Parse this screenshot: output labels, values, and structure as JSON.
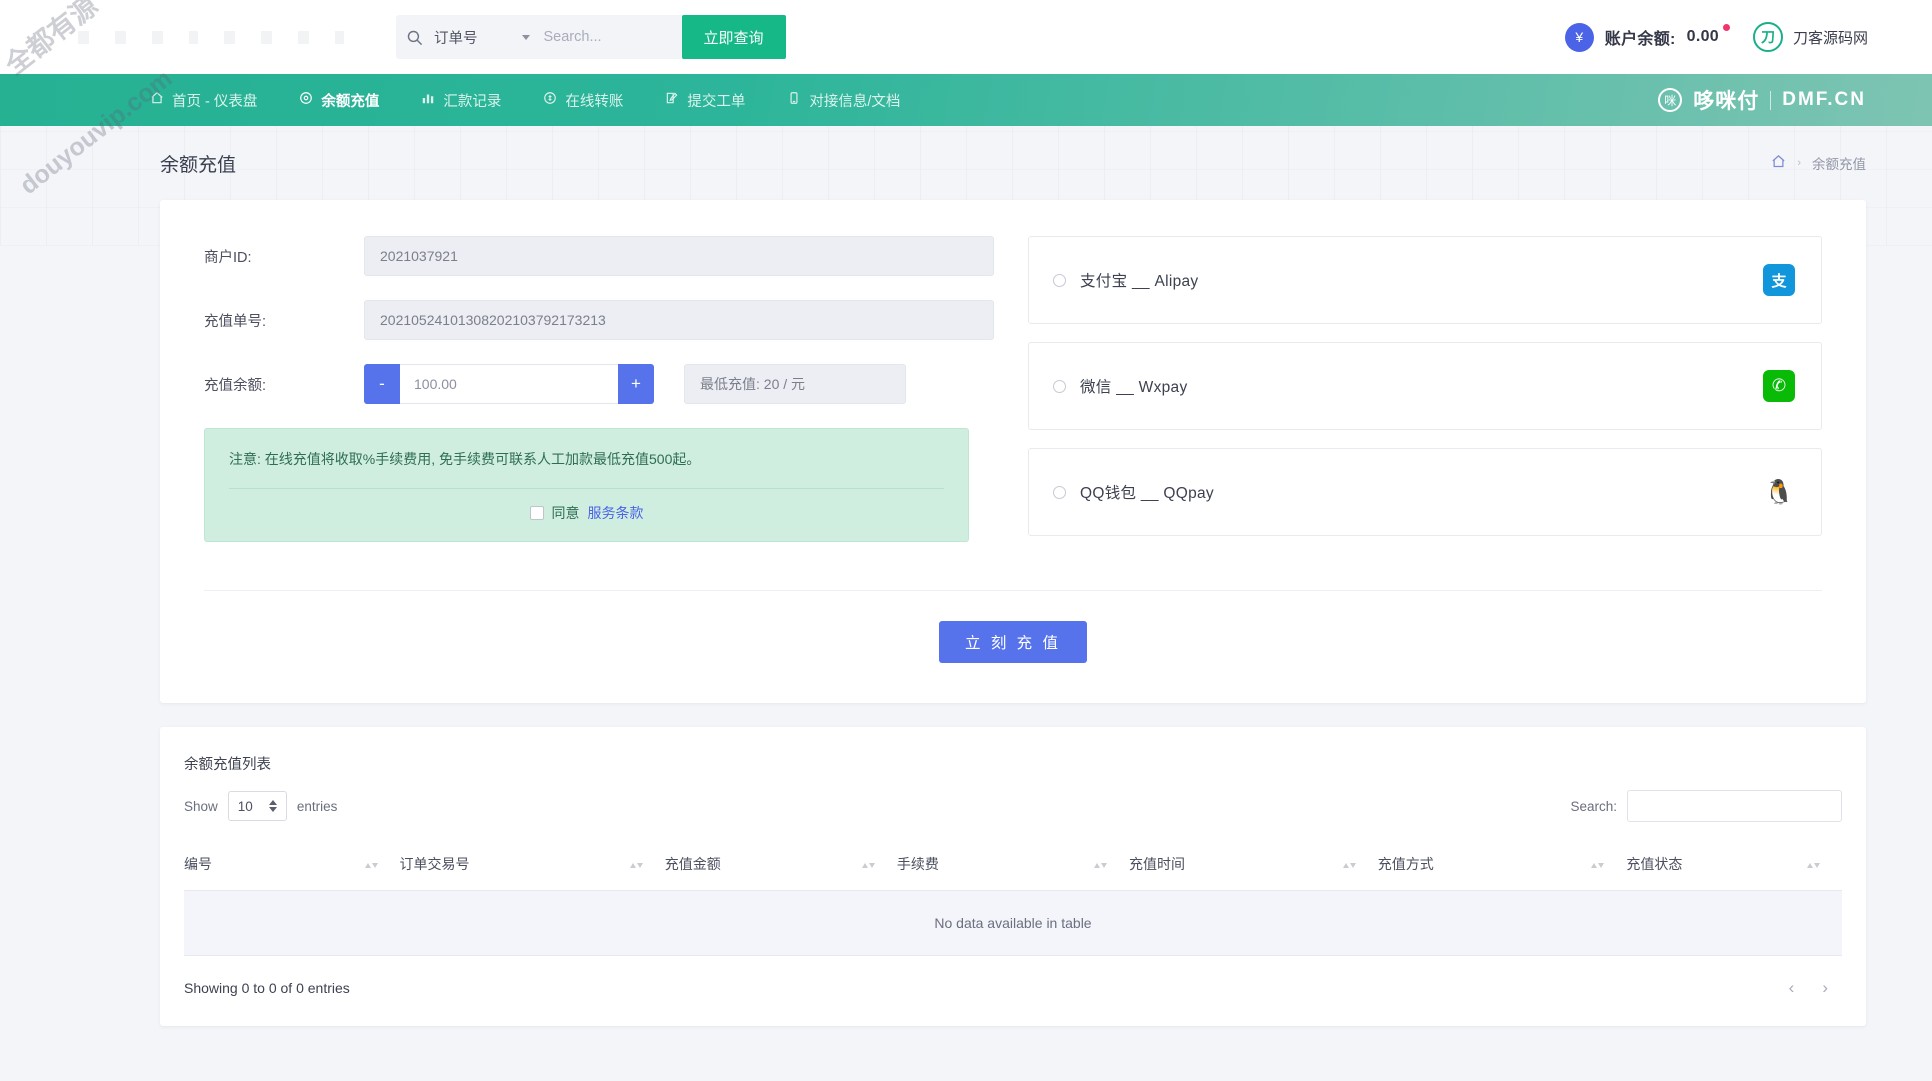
{
  "topbar": {
    "search_category": "订单号",
    "search_placeholder": "Search...",
    "query_button": "立即查询",
    "balance_label": "账户余额:",
    "balance_value": "0.00",
    "currency_symbol": "¥",
    "site_name": "刀客源码网",
    "site_mark": "刀"
  },
  "nav": {
    "items": [
      {
        "label": "首页 - 仪表盘",
        "icon": "home-icon",
        "active": false
      },
      {
        "label": "余额充值",
        "icon": "target-icon",
        "active": true
      },
      {
        "label": "汇款记录",
        "icon": "bars-icon",
        "active": false
      },
      {
        "label": "在线转账",
        "icon": "circle-dollar-icon",
        "active": false
      },
      {
        "label": "提交工单",
        "icon": "edit-icon",
        "active": false
      },
      {
        "label": "对接信息/文档",
        "icon": "book-icon",
        "active": false
      }
    ],
    "brand_cn": "哆咪付",
    "brand_en": "DMF.CN",
    "brand_mark": "咪"
  },
  "page": {
    "title": "余额充值",
    "breadcrumb_home": "⌂",
    "breadcrumb_sep": "›",
    "breadcrumb_current": "余额充值"
  },
  "form": {
    "merchant_id_label": "商户ID:",
    "merchant_id_value": "2021037921",
    "order_no_label": "充值单号:",
    "order_no_value": "20210524101308202103792173213",
    "amount_label": "充值余额:",
    "amount_value": "100.00",
    "minus": "-",
    "plus": "+",
    "min_hint": "最低充值: 20 / 元"
  },
  "notice": {
    "text": "注意: 在线充值将收取%手续费用, 免手续费可联系人工加款最低充值500起。",
    "agree_label": "同意",
    "terms_link": "服务条款"
  },
  "payments": [
    {
      "label": "支付宝 __ Alipay",
      "icon": "alipay-icon",
      "glyph": "支",
      "selected": false
    },
    {
      "label": "微信 __ Wxpay",
      "icon": "wechat-icon",
      "glyph": "✆",
      "selected": false
    },
    {
      "label": "QQ钱包 __ QQpay",
      "icon": "qq-penguin-icon",
      "glyph": "🐧",
      "selected": false
    }
  ],
  "submit": {
    "label": "立 刻 充 值"
  },
  "table": {
    "title": "余额充值列表",
    "show_label": "Show",
    "page_length": "10",
    "entries_label": "entries",
    "search_label": "Search:",
    "search_value": "",
    "columns": [
      "编号",
      "订单交易号",
      "充值金额",
      "手续费",
      "充值时间",
      "充值方式",
      "充值状态"
    ],
    "rows": [],
    "empty_text": "No data available in table",
    "info": "Showing 0 to 0 of 0 entries",
    "prev": "‹",
    "next": "›"
  },
  "watermark": {
    "line1": "全都有源",
    "line2": "douyouvip.com"
  },
  "colors": {
    "nav_green": "#26b193",
    "primary_blue": "#5773ec",
    "query_green": "#15b886",
    "notice_green": "#cfeee0",
    "alipay_blue": "#1296db",
    "wechat_green": "#09bb07"
  }
}
